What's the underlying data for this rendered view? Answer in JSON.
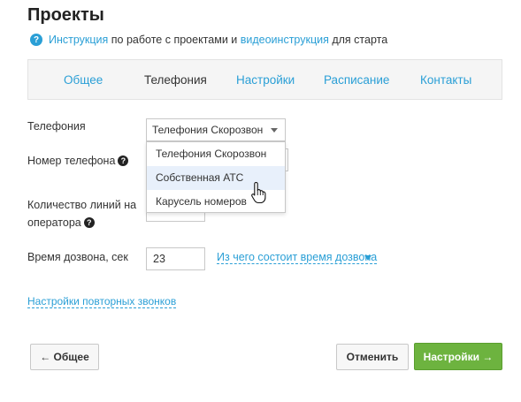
{
  "page": {
    "title": "Проекты"
  },
  "help": {
    "link1": "Инструкция",
    "text1": " по работе с проектами и ",
    "link2": "видеоинструкция",
    "text2": " для старта",
    "icon": "question-circle-icon"
  },
  "tabs": [
    {
      "label": "Общее",
      "active": false
    },
    {
      "label": "Телефония",
      "active": true
    },
    {
      "label": "Настройки",
      "active": false
    },
    {
      "label": "Расписание",
      "active": false
    },
    {
      "label": "Контакты",
      "active": false
    }
  ],
  "form": {
    "telephony_label": "Телефония",
    "telephony_selected": "Телефония Скорозвон",
    "phone_label": "Номер телефона",
    "lines_label_line1": "Количество линий на",
    "lines_label_line2": "оператора",
    "dial_time_label": "Время дозвона, сек",
    "dial_time_value": "23",
    "dial_time_help_link": "Из чего состоит время дозвона"
  },
  "dropdown": {
    "options": [
      "Телефония Скорозвон",
      "Собственная АТС",
      "Карусель номеров"
    ],
    "highlighted_index": 1
  },
  "links": {
    "retry_settings": "Настройки повторных звонков"
  },
  "buttons": {
    "back": "← Общее",
    "cancel": "Отменить",
    "next": "Настройки →"
  },
  "colors": {
    "link": "#2a9fd6",
    "primary_button": "#6db33f",
    "highlight": "#e8f0fb"
  }
}
